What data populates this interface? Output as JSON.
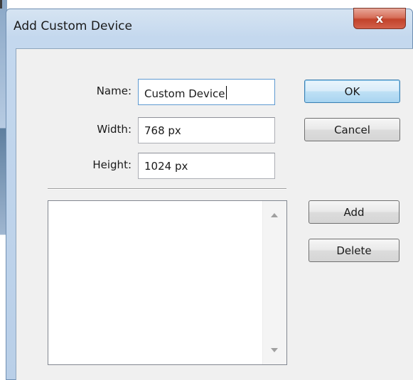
{
  "window": {
    "title": "Add Custom Device",
    "close_glyph": "x"
  },
  "form": {
    "name_label": "Name:",
    "name_value": "Custom Device",
    "width_label": "Width:",
    "width_value": "768 px",
    "height_label": "Height:",
    "height_value": "1024 px"
  },
  "buttons": {
    "ok": "OK",
    "cancel": "Cancel",
    "add": "Add",
    "delete": "Delete"
  },
  "device_list": {
    "items": []
  },
  "icons": {
    "close": "close-icon",
    "scroll_up": "scroll-up-arrow-icon",
    "scroll_down": "scroll-down-arrow-icon"
  }
}
